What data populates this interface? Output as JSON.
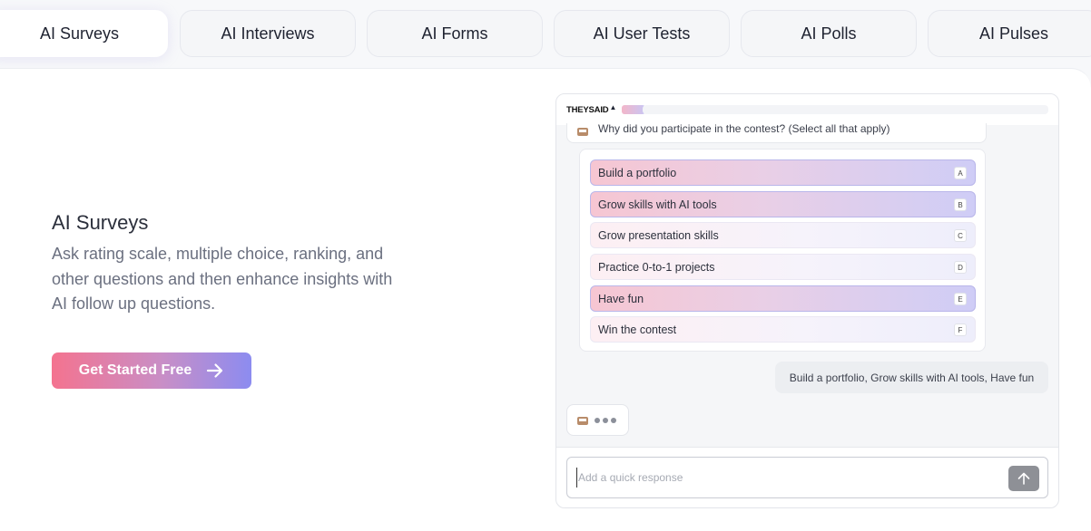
{
  "tabs": [
    {
      "label": "AI Surveys",
      "active": true
    },
    {
      "label": "AI Interviews",
      "active": false
    },
    {
      "label": "AI Forms",
      "active": false
    },
    {
      "label": "AI User Tests",
      "active": false
    },
    {
      "label": "AI Polls",
      "active": false
    },
    {
      "label": "AI Pulses",
      "active": false
    }
  ],
  "feature": {
    "title": "AI Surveys",
    "description": "Ask rating scale, multiple choice, ranking, and other questions and then enhance insights with AI follow up questions.",
    "cta_label": "Get Started Free",
    "cta_icon": "arrow-right-icon"
  },
  "chat": {
    "brand": "THEYSAID",
    "question": "Why did you participate in the contest? (Select all that apply)",
    "options": [
      {
        "label": "Build a portfolio",
        "key": "A",
        "selected": true
      },
      {
        "label": "Grow skills with AI tools",
        "key": "B",
        "selected": true
      },
      {
        "label": "Grow presentation skills",
        "key": "C",
        "selected": false
      },
      {
        "label": "Practice 0-to-1 projects",
        "key": "D",
        "selected": false
      },
      {
        "label": "Have fun",
        "key": "E",
        "selected": true
      },
      {
        "label": "Win the contest",
        "key": "F",
        "selected": false
      }
    ],
    "answer": "Build a portfolio, Grow skills with AI tools, Have fun",
    "input_placeholder": "Add a quick response",
    "send_icon": "arrow-up-icon"
  },
  "colors": {
    "cta_gradient_start": "#f4738f",
    "cta_gradient_end": "#8c8cf0",
    "selected_option_start": "#f6c6d2",
    "selected_option_end": "#cfcdf6"
  }
}
